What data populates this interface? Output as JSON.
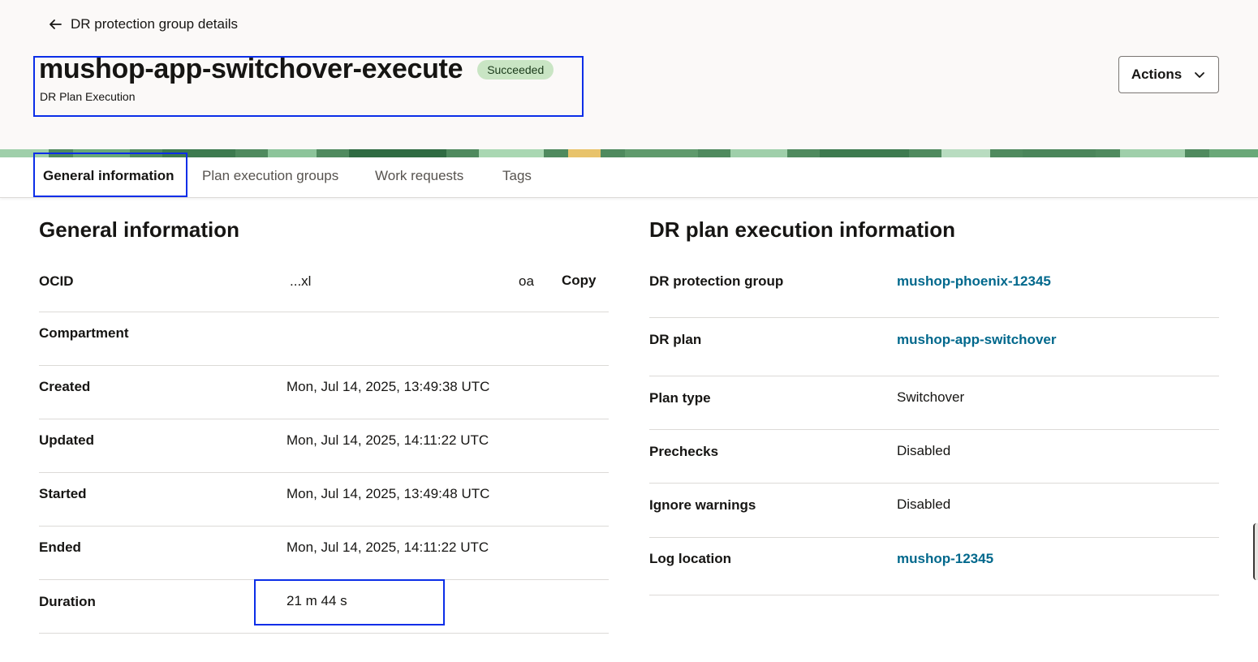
{
  "header": {
    "back_label": "DR protection group details",
    "title": "mushop-app-switchover-execute",
    "status": "Succeeded",
    "subtitle": "DR Plan Execution",
    "actions_label": "Actions"
  },
  "tabs": [
    {
      "label": "General information"
    },
    {
      "label": "Plan execution groups"
    },
    {
      "label": "Work requests"
    },
    {
      "label": "Tags"
    }
  ],
  "general": {
    "title": "General information",
    "ocid_label": "OCID",
    "ocid_value": "...xl",
    "ocid_suffix": "oa",
    "copy_label": "Copy",
    "compartment_label": "Compartment",
    "compartment_value": "",
    "created_label": "Created",
    "created_value": "Mon, Jul 14, 2025, 13:49:38 UTC",
    "updated_label": "Updated",
    "updated_value": "Mon, Jul 14, 2025, 14:11:22 UTC",
    "started_label": "Started",
    "started_value": "Mon, Jul 14, 2025, 13:49:48 UTC",
    "ended_label": "Ended",
    "ended_value": "Mon, Jul 14, 2025, 14:11:22 UTC",
    "duration_label": "Duration",
    "duration_value": "21 m 44 s"
  },
  "execution": {
    "title": "DR plan execution information",
    "group_label": "DR protection group",
    "group_value": "mushop-phoenix-12345",
    "plan_label": "DR plan",
    "plan_value": "mushop-app-switchover",
    "type_label": "Plan type",
    "type_value": "Switchover",
    "prechecks_label": "Prechecks",
    "prechecks_value": "Disabled",
    "warnings_label": "Ignore warnings",
    "warnings_value": "Disabled",
    "log_label": "Log location",
    "log_value": "mushop-12345"
  },
  "colors": {
    "link": "#00688c",
    "badge_bg": "#c9e5c4",
    "highlight": "#0b2ee8",
    "header_bg": "#fbf9f8"
  }
}
